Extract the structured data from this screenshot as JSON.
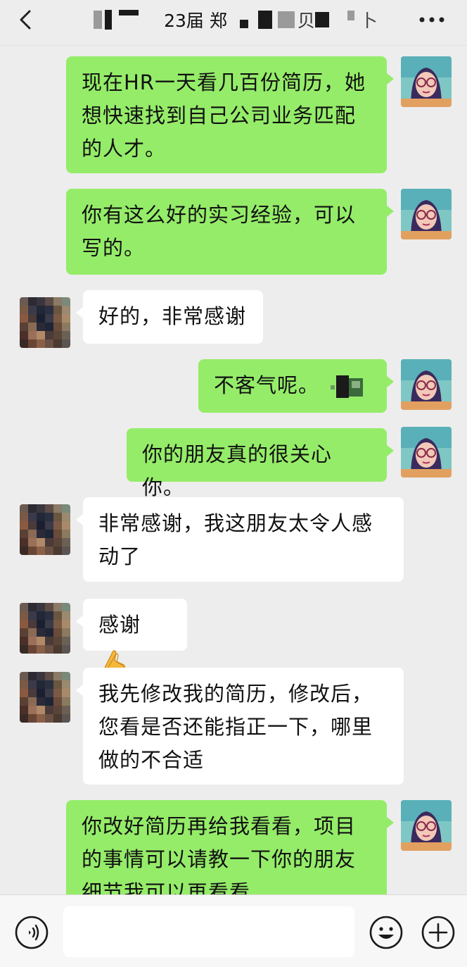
{
  "header": {
    "title_parts": [
      "23届 郑",
      "贝",
      "卜"
    ],
    "more_label": "更多"
  },
  "messages": [
    {
      "from": "me",
      "text": "现在HR一天看几百份简历，她想快速找到自己公司业务匹配的人才。"
    },
    {
      "from": "me",
      "text": "你有这么好的实习经验，可以写的。"
    },
    {
      "from": "them",
      "text": "好的，非常感谢"
    },
    {
      "from": "me",
      "text": "不客气呢。"
    },
    {
      "from": "me",
      "text": "你的朋友真的很关心你。"
    },
    {
      "from": "them",
      "text": "非常感谢，我这朋友太令人感动了"
    },
    {
      "from": "them",
      "text": "感谢",
      "emoji": "folded-hands-emoji"
    },
    {
      "from": "them",
      "text": "我先修改我的简历，修改后，您看是否还能指正一下，哪里做的不合适"
    },
    {
      "from": "me",
      "text": "你改好简历再给我看看，项目的事情可以请教一下你的朋友细节我可以再看看"
    }
  ],
  "input": {
    "value": "",
    "placeholder": ""
  },
  "icons": {
    "back": "chevron-left-icon",
    "more": "more-dots-icon",
    "voice": "voice-icon",
    "emoji": "smiley-icon",
    "plus": "plus-icon"
  },
  "colors": {
    "background": "#ededed",
    "my_bubble": "#95ec69",
    "their_bubble": "#ffffff",
    "input_bar": "#f7f7f7"
  }
}
